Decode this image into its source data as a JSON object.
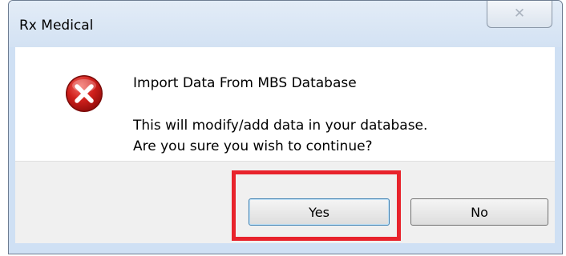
{
  "window": {
    "title": "Rx Medical",
    "close_glyph": "✕"
  },
  "message": {
    "heading": "Import Data From MBS Database",
    "line1": "This will modify/add data in your database.",
    "line2": "Are you sure you wish to continue?",
    "icon": "error-icon"
  },
  "buttons": {
    "yes_label": "Yes",
    "no_label": "No"
  },
  "colors": {
    "highlight": "#e8232c",
    "icon_red": "#c8171c",
    "frame": "#cfe0f4"
  }
}
